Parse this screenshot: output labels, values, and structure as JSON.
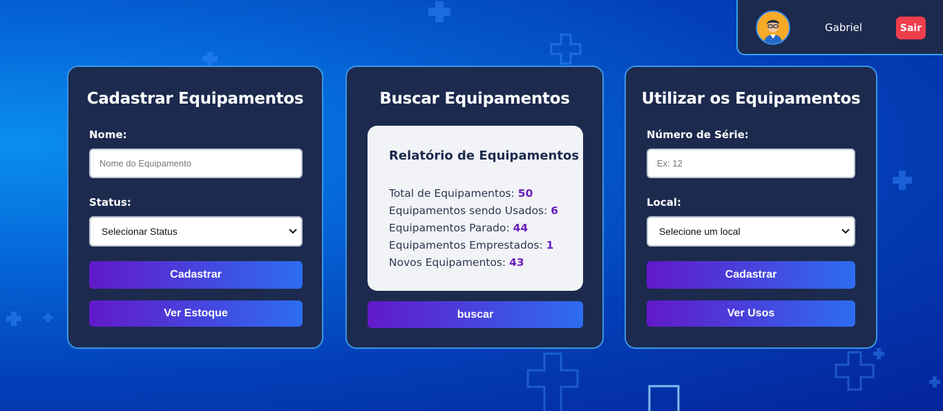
{
  "user": {
    "name": "Gabriel",
    "logout_label": "Sair",
    "avatar_icon": "user-avatar-icon"
  },
  "register_card": {
    "title": "Cadastrar Equipamentos",
    "name_label": "Nome:",
    "name_placeholder": "Nome do Equipamento",
    "status_label": "Status:",
    "status_selected": "Selecionar Status",
    "submit_label": "Cadastrar",
    "stock_label": "Ver Estoque"
  },
  "search_card": {
    "title": "Buscar Equipamentos",
    "report": {
      "title": "Relatório de Equipamentos",
      "rows": [
        {
          "label": "Total de Equipamentos:",
          "value": "50"
        },
        {
          "label": "Equipamentos sendo Usados:",
          "value": "6"
        },
        {
          "label": "Equipamentos Parado:",
          "value": "44"
        },
        {
          "label": "Equipamentos Emprestados:",
          "value": "1"
        },
        {
          "label": "Novos Equipamentos:",
          "value": "43"
        }
      ]
    },
    "search_label": "buscar"
  },
  "use_card": {
    "title": "Utilizar os Equipamentos",
    "serial_label": "Número de Série:",
    "serial_placeholder": "Ex: 12",
    "location_label": "Local:",
    "location_selected": "Selecione um local",
    "submit_label": "Cadastrar",
    "usage_label": "Ver Usos"
  },
  "colors": {
    "card_bg": "#1c2a4e",
    "card_border": "#3b95e6",
    "button_gradient_start": "#6219c9",
    "button_gradient_end": "#2d6df0",
    "logout_red": "#ef3e4c",
    "report_value": "#6a1fbe"
  }
}
